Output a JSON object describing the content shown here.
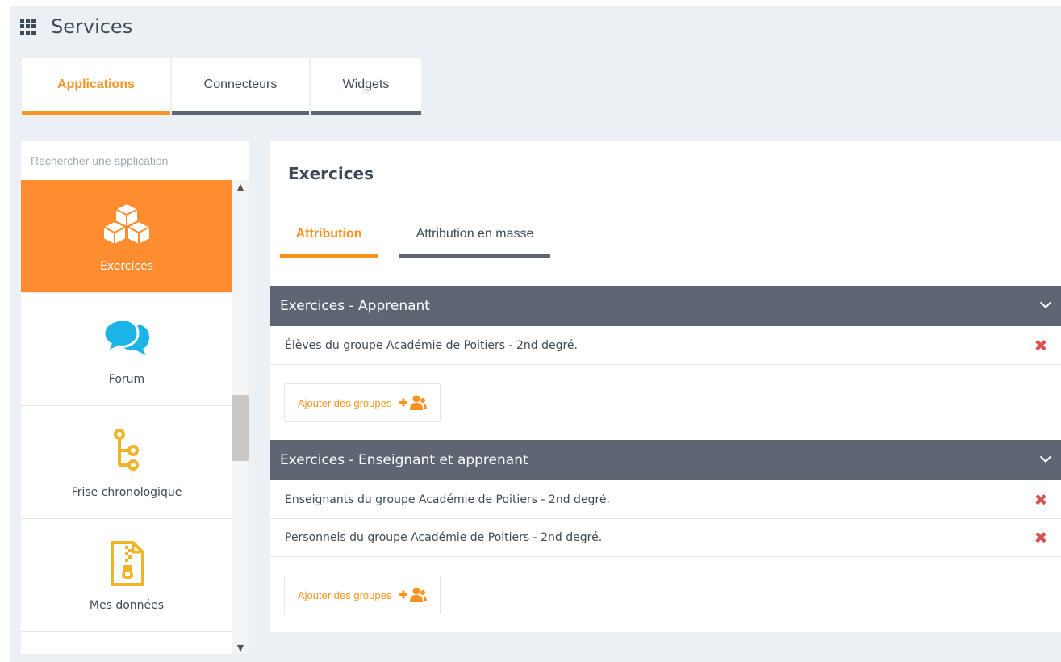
{
  "header": {
    "title": "Services",
    "icon": "grid-icon"
  },
  "top_tabs": [
    {
      "label": "Applications",
      "active": true
    },
    {
      "label": "Connecteurs",
      "active": false
    },
    {
      "label": "Widgets",
      "active": false
    }
  ],
  "sidebar": {
    "search_placeholder": "Rechercher une application",
    "items": [
      {
        "label": "Exercices",
        "icon": "cubes-icon",
        "active": true
      },
      {
        "label": "Forum",
        "icon": "chat-bubbles-icon",
        "active": false
      },
      {
        "label": "Frise chronologique",
        "icon": "timeline-icon",
        "active": false
      },
      {
        "label": "Mes données",
        "icon": "zip-file-icon",
        "active": false
      }
    ]
  },
  "main": {
    "title": "Exercices",
    "tabs": [
      {
        "label": "Attribution",
        "active": true
      },
      {
        "label": "Attribution en masse",
        "active": false
      }
    ],
    "sections": [
      {
        "title": "Exercices - Apprenant",
        "groups": [
          "Élèves du groupe Académie de Poitiers - 2nd degré."
        ],
        "add_label": "Ajouter des groupes"
      },
      {
        "title": "Exercices - Enseignant et apprenant",
        "groups": [
          "Enseignants du groupe Académie de Poitiers - 2nd degré.",
          "Personnels du groupe Académie de Poitiers - 2nd degré."
        ],
        "add_label": "Ajouter des groupes"
      }
    ]
  },
  "colors": {
    "accent": "#f7931e",
    "active_bg": "#ff8c2e",
    "header_bar": "#5d6672",
    "remove": "#d9534f",
    "page_bg": "#eceff3"
  }
}
